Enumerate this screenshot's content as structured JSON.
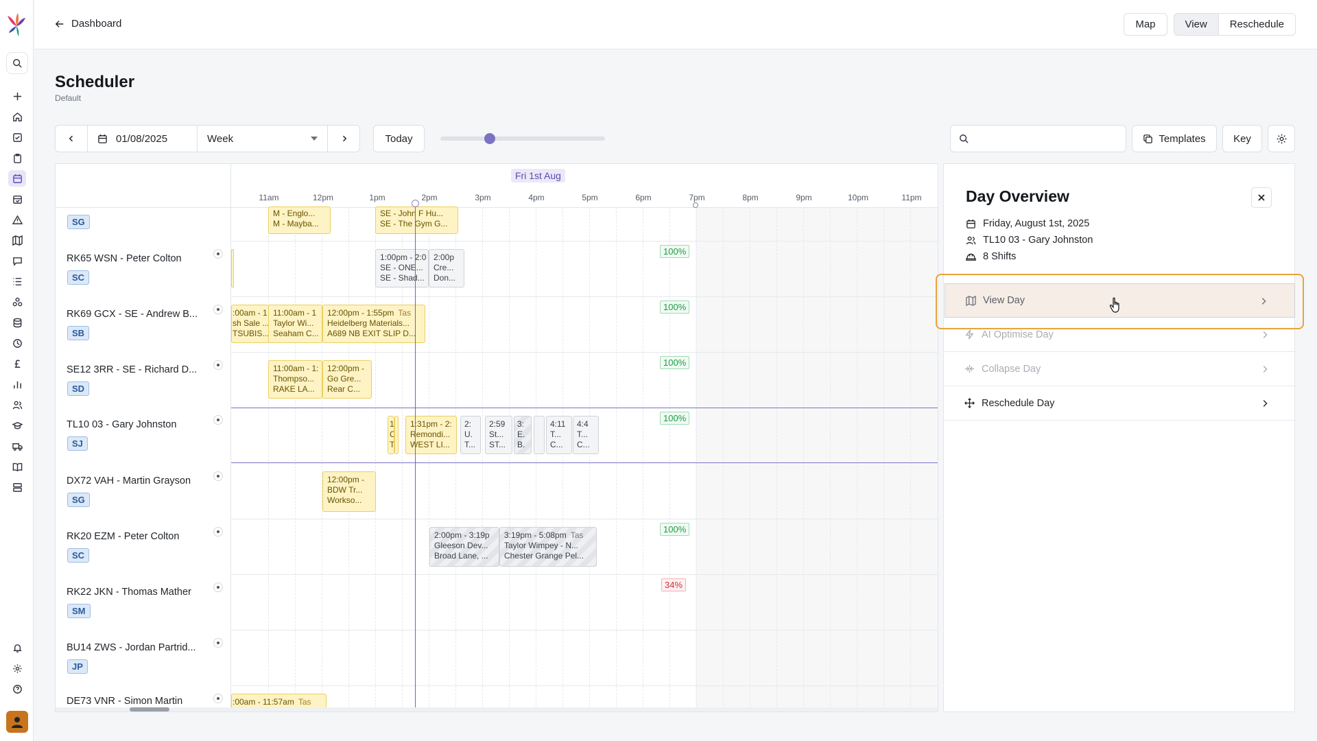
{
  "topbar": {
    "back_label": "Dashboard",
    "map_label": "Map",
    "view_label": "View",
    "reschedule_label": "Reschedule"
  },
  "page": {
    "title": "Scheduler",
    "subtitle": "Default"
  },
  "toolbar": {
    "date": "01/08/2025",
    "range": "Week",
    "today_label": "Today",
    "zoom_level": 0.3,
    "search_value": "",
    "templates_label": "Templates",
    "key_label": "Key"
  },
  "grid": {
    "day_header": "Fri 1st Aug",
    "hours": [
      "11am",
      "12pm",
      "1pm",
      "2pm",
      "3pm",
      "4pm",
      "5pm",
      "6pm",
      "7pm",
      "8pm",
      "9pm",
      "10pm",
      "11pm"
    ],
    "rows": [
      {
        "name": "",
        "badge": "SG",
        "utilisation": ""
      },
      {
        "name": "RK65 WSN - Peter Colton",
        "badge": "SC",
        "utilisation": "100%"
      },
      {
        "name": "RK69 GCX - SE - Andrew B...",
        "badge": "SB",
        "utilisation": "100%"
      },
      {
        "name": "SE12 3RR - SE - Richard D...",
        "badge": "SD",
        "utilisation": "100%"
      },
      {
        "name": "TL10 03 - Gary Johnston",
        "badge": "SJ",
        "utilisation": "100%"
      },
      {
        "name": "DX72 VAH - Martin Grayson",
        "badge": "SG",
        "utilisation": ""
      },
      {
        "name": "RK20 EZM - Peter Colton",
        "badge": "SC",
        "utilisation": "100%"
      },
      {
        "name": "RK22 JKN - Thomas Mather",
        "badge": "SM",
        "utilisation": "34%"
      },
      {
        "name": "BU14 ZWS - Jordan Partrid...",
        "badge": "JP",
        "utilisation": ""
      },
      {
        "name": "DE73 VNR - Simon Martin",
        "badge": "",
        "utilisation": ""
      }
    ],
    "shifts": [
      {
        "l1": "M - Englo...",
        "l2": "M - Mayba...",
        "l3": ""
      },
      {
        "l1": "SE - John F Hu...",
        "l2": "SE - The Gym G...",
        "l3": ""
      },
      {
        "l1": "1:00pm - 2:0",
        "l2": "SE - ONE...",
        "l3": "SE - Shad..."
      },
      {
        "l1": "2:00p",
        "l2": "Cre...",
        "l3": "Don..."
      },
      {
        "l1": ":00am - 1",
        "l2": "sh Sale ...",
        "l3": "TSUBIS..."
      },
      {
        "l1": "11:00am - 1",
        "l2": "Taylor Wi...",
        "l3": "Seaham C..."
      },
      {
        "l1": "12:00pm - 1:55pm",
        "tag": "Tas",
        "l2": "Heidelberg Materials...",
        "l3": "A689 NB EXIT SLIP D..."
      },
      {
        "l1": "11:00am - 1:",
        "l2": "Thompso...",
        "l3": "RAKE LA..."
      },
      {
        "l1": "12:00pm -",
        "l2": "Go Gre...",
        "l3": "Rear C..."
      },
      {
        "l1": "1",
        "l2": "C",
        "l3": "T"
      },
      {
        "l1": "1:31pm - 2:",
        "l2": "Remondi...",
        "l3": "WEST LI..."
      },
      {
        "l1": "2:",
        "l2": "U.",
        "l3": "T..."
      },
      {
        "l1": "2:59",
        "l2": "St...",
        "l3": "ST..."
      },
      {
        "l1": "3:",
        "l2": "E.",
        "l3": "B."
      },
      {
        "l1": "4:11",
        "l2": "T...",
        "l3": "C..."
      },
      {
        "l1": "4:4",
        "l2": "T...",
        "l3": "C..."
      },
      {
        "l1": "12:00pm -",
        "l2": "BDW Tr...",
        "l3": "Workso..."
      },
      {
        "l1": "2:00pm - 3:19p",
        "l2": "Gleeson Dev...",
        "l3": "Broad Lane, ..."
      },
      {
        "l1": "3:19pm - 5:08pm",
        "tag": "Tas",
        "l2": "Taylor Wimpey - N...",
        "l3": "Chester Grange Pel..."
      },
      {
        "l1": ":00am - 11:57am",
        "tag": "Tas",
        "l2": "",
        "l3": ""
      }
    ]
  },
  "panel": {
    "title": "Day Overview",
    "date": "Friday, August 1st, 2025",
    "resource": "TL10 03 - Gary Johnston",
    "shifts_count": "8 Shifts",
    "actions": {
      "view_day": "View Day",
      "ai_optimise_day": "AI Optimise Day",
      "collapse_day": "Collapse Day",
      "reschedule_day": "Reschedule Day"
    }
  },
  "colors": {
    "accent": "#6d63c6",
    "shift_yellow": "#fdf3c4",
    "focus_ring": "#e8a33a",
    "success": "#1f9a4a",
    "danger": "#d4323f"
  }
}
